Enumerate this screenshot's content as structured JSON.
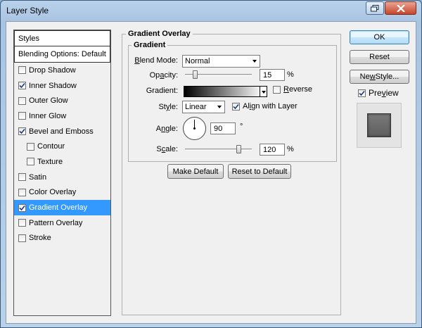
{
  "window": {
    "title": "Layer Style"
  },
  "styles_list": {
    "header": "Styles",
    "blending": "Blending Options: Default",
    "items": [
      {
        "label": "Drop Shadow",
        "checked": false,
        "sub": false,
        "selected": false
      },
      {
        "label": "Inner Shadow",
        "checked": true,
        "sub": false,
        "selected": false
      },
      {
        "label": "Outer Glow",
        "checked": false,
        "sub": false,
        "selected": false
      },
      {
        "label": "Inner Glow",
        "checked": false,
        "sub": false,
        "selected": false
      },
      {
        "label": "Bevel and Emboss",
        "checked": true,
        "sub": false,
        "selected": false
      },
      {
        "label": "Contour",
        "checked": false,
        "sub": true,
        "selected": false
      },
      {
        "label": "Texture",
        "checked": false,
        "sub": true,
        "selected": false
      },
      {
        "label": "Satin",
        "checked": false,
        "sub": false,
        "selected": false
      },
      {
        "label": "Color Overlay",
        "checked": false,
        "sub": false,
        "selected": false
      },
      {
        "label": "Gradient Overlay",
        "checked": true,
        "sub": false,
        "selected": true
      },
      {
        "label": "Pattern Overlay",
        "checked": false,
        "sub": false,
        "selected": false
      },
      {
        "label": "Stroke",
        "checked": false,
        "sub": false,
        "selected": false
      }
    ]
  },
  "panel": {
    "title": "Gradient Overlay",
    "group": "Gradient",
    "blend_mode": {
      "label_pre": "B",
      "label_post": "lend Mode:",
      "value": "Normal"
    },
    "opacity": {
      "label_pre": "Op",
      "label_u": "a",
      "label_post": "city:",
      "value": "15",
      "unit": "%",
      "level_pct": 15
    },
    "gradient": {
      "label": "Gradient:",
      "reverse_pre": "R",
      "reverse_post": "everse",
      "reverse_checked": false
    },
    "style": {
      "label_pre": "St",
      "label_u": "y",
      "label_post": "le:",
      "value": "Linear",
      "align_pre": "Al",
      "align_u": "i",
      "align_post": "gn with Layer",
      "align_checked": true
    },
    "angle": {
      "label_pre": "A",
      "label_u": "n",
      "label_post": "gle:",
      "value": "90",
      "unit": "°"
    },
    "scale": {
      "label_pre": "S",
      "label_u": "c",
      "label_post": "ale:",
      "value": "120",
      "unit": "%",
      "level_pct": 80
    },
    "make_default": "Make Default",
    "reset_default": "Reset to Default"
  },
  "right": {
    "ok": "OK",
    "reset": "Reset",
    "new_style_pre": "Ne",
    "new_style_u": "w",
    "new_style_post": " Style...",
    "preview_pre": "Pre",
    "preview_u": "v",
    "preview_post": "iew",
    "preview_checked": true
  }
}
